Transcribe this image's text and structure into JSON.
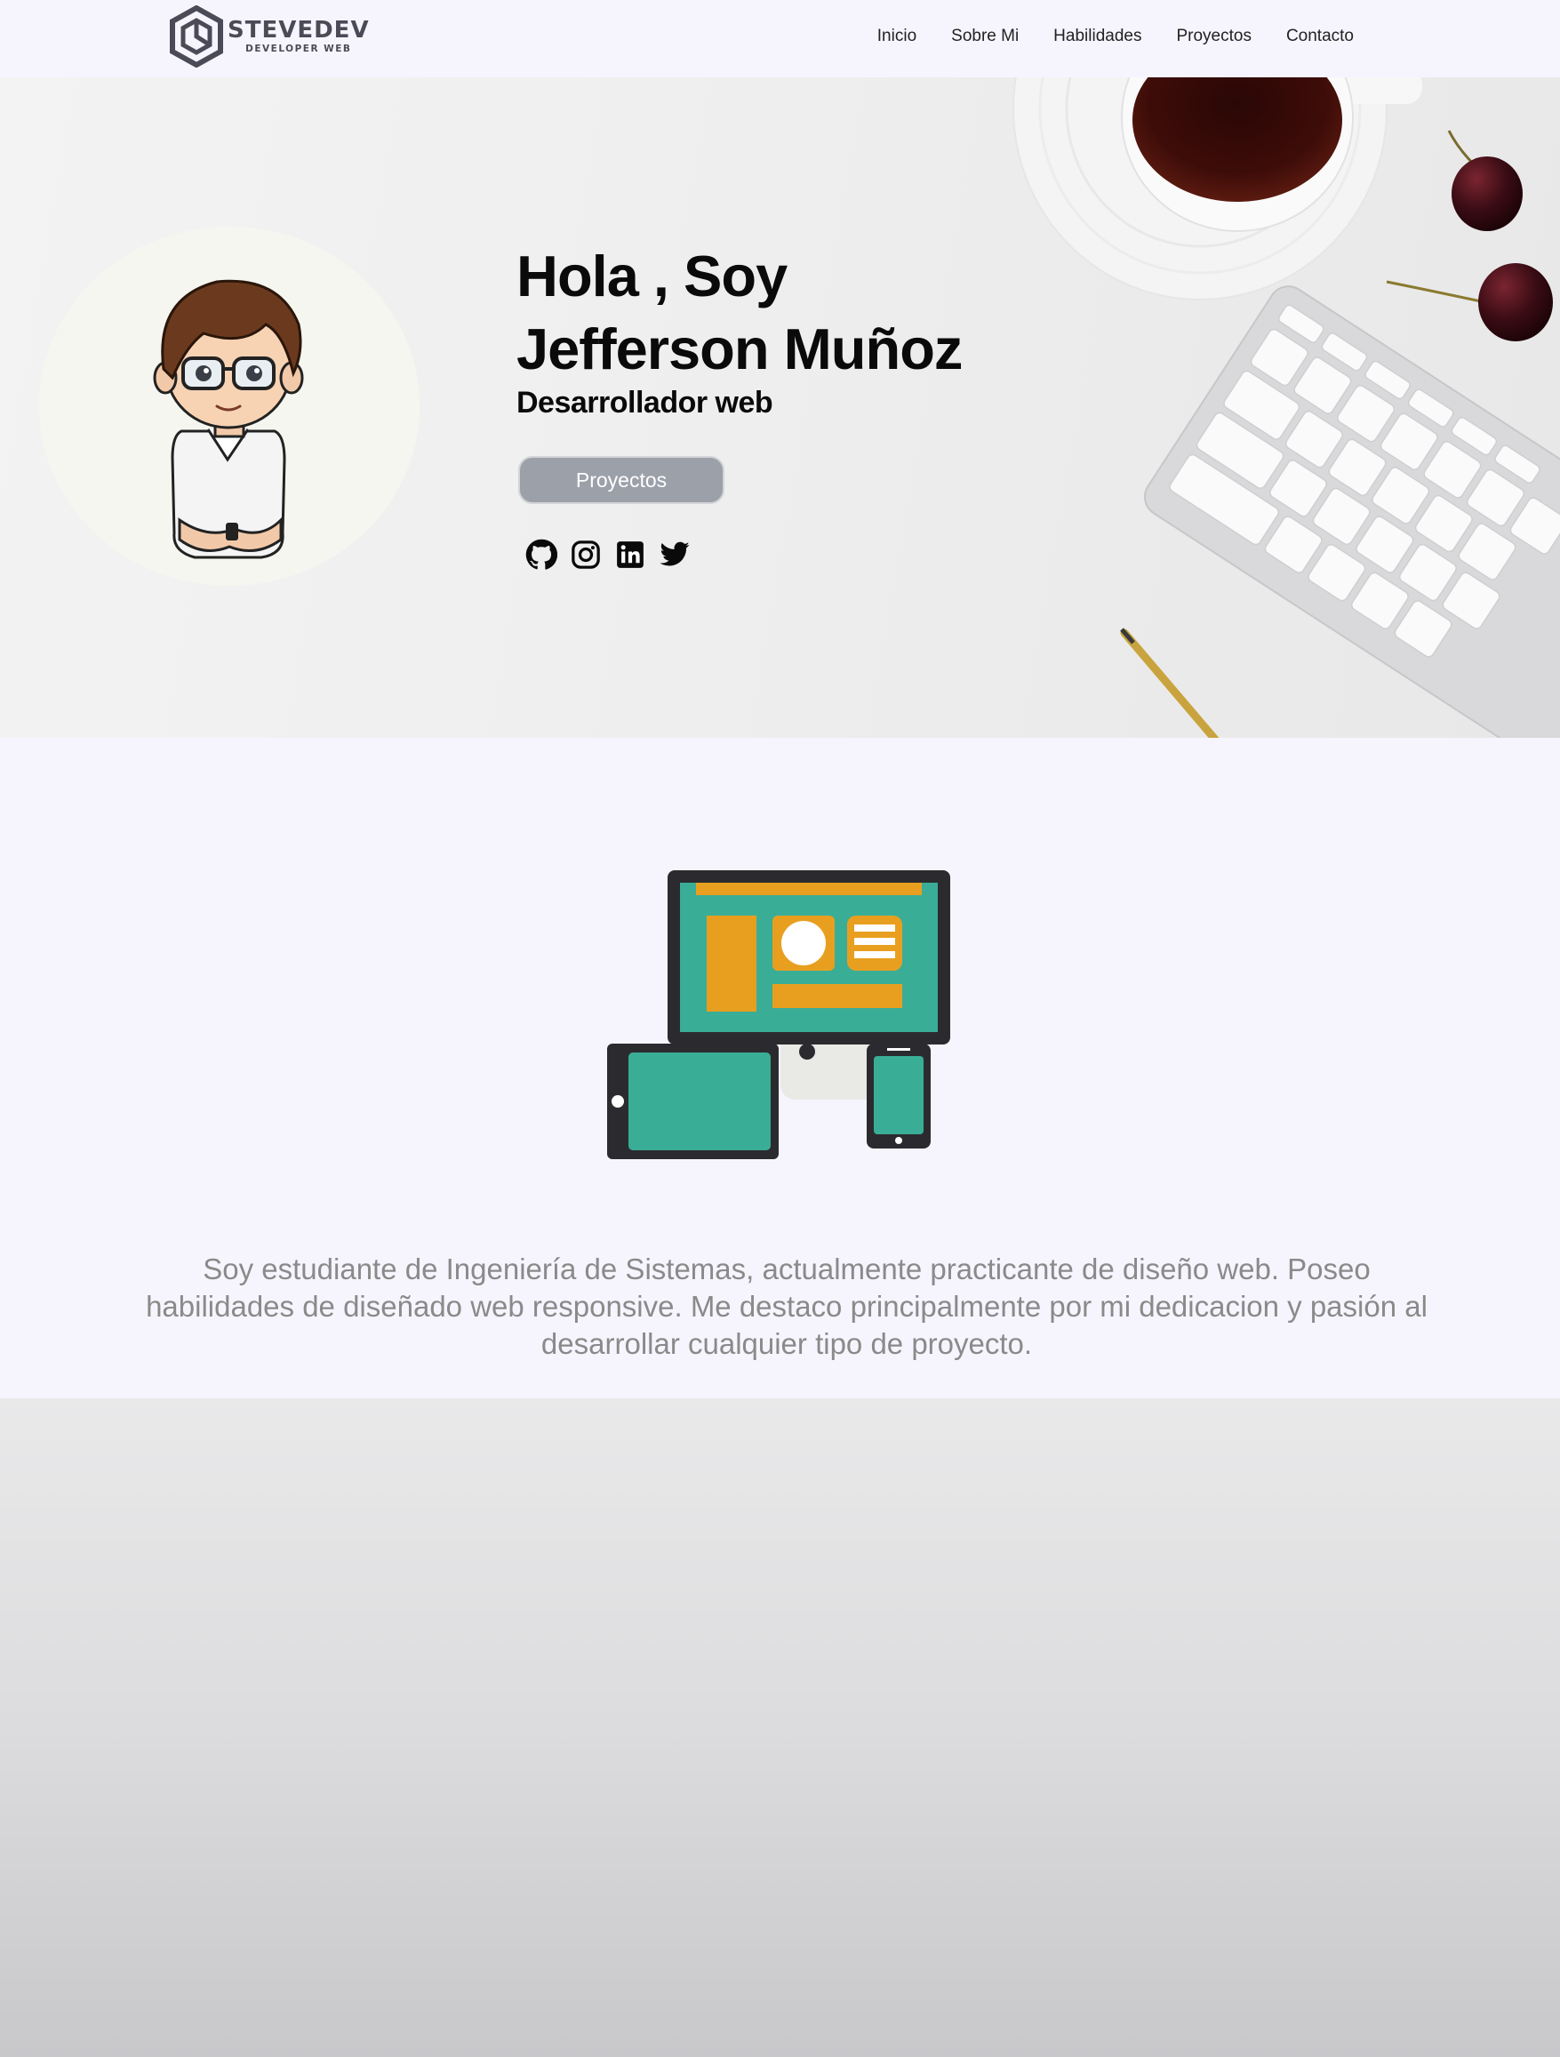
{
  "brand": {
    "name": "STEVEDEV",
    "tagline": "DEVELOPER WEB",
    "logo_color": "#4b4b57"
  },
  "nav": {
    "items": [
      {
        "label": "Inicio"
      },
      {
        "label": "Sobre Mi"
      },
      {
        "label": "Habilidades"
      },
      {
        "label": "Proyectos"
      },
      {
        "label": "Contacto"
      }
    ]
  },
  "hero": {
    "greeting_line1": "Hola , Soy",
    "greeting_line2": "Jefferson Muñoz",
    "role": "Desarrollador web",
    "cta_label": "Proyectos",
    "cta_color": "#9ca0a9",
    "social_icons": [
      "github-icon",
      "instagram-icon",
      "linkedin-icon",
      "twitter-icon"
    ],
    "background_items": [
      "coffee-cup",
      "cherries",
      "keyboard",
      "pen"
    ]
  },
  "about": {
    "illustration": "responsive-devices",
    "text": "Soy estudiante de Ingeniería de Sistemas, actualmente practicante de diseño web. Poseo habilidades de diseñado web responsive. Me destaco principalmente por mi dedicacion y pasión al desarrollar cualquier tipo de proyecto.",
    "colors": {
      "teal": "#3aad97",
      "orange": "#e89f1f",
      "frame": "#2b2b2f"
    }
  }
}
